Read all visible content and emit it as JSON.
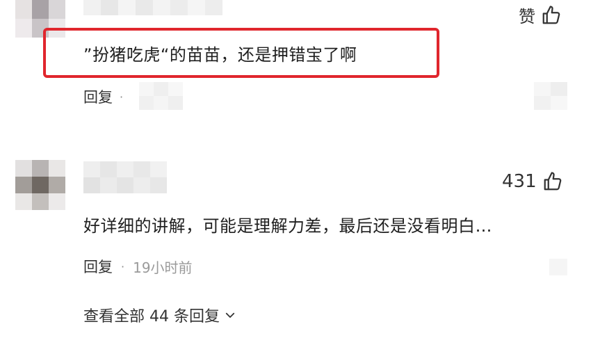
{
  "comment1": {
    "text": "”扮猪吃虎“的苗苗，还是押错宝了啊",
    "reply_label": "回复",
    "like_label": "赞",
    "meta_dot": "·"
  },
  "comment2": {
    "text": "好详细的讲解，可能是理解力差，最后还是没看明白…",
    "reply_label": "回复",
    "meta_dot": "·",
    "time": "19小时前",
    "like_count": "431"
  },
  "view_all": {
    "label": "查看全部 44 条回复"
  },
  "colors": {
    "highlight": "#e0262d"
  },
  "icons": [
    "thumbs-up-icon",
    "chevron-down-icon"
  ]
}
